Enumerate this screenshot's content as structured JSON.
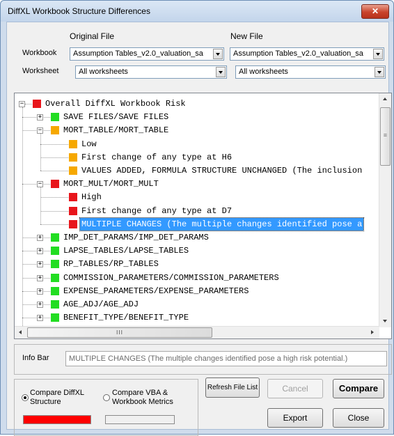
{
  "window": {
    "title": "DiffXL Workbook Structure Differences",
    "close_glyph": "✕"
  },
  "labels": {
    "original_file": "Original File",
    "new_file": "New File",
    "workbook": "Workbook",
    "worksheet": "Worksheet",
    "info_bar": "Info Bar"
  },
  "original": {
    "workbook_value": "Assumption Tables_v2.0_valuation_sa",
    "worksheet_value": "All worksheets"
  },
  "new": {
    "workbook_value": "Assumption Tables_v2.0_valuation_sa",
    "worksheet_value": "All worksheets"
  },
  "tree": {
    "nodes": [
      {
        "text": "Overall DiffXL Workbook Risk",
        "color": "#e8151b",
        "level": 0,
        "toggle": "−"
      },
      {
        "text": "SAVE FILES/SAVE FILES",
        "color": "#22dd22",
        "level": 1,
        "toggle": "+"
      },
      {
        "text": "MORT_TABLE/MORT_TABLE",
        "color": "#f6a800",
        "level": 1,
        "toggle": "−"
      },
      {
        "text": "Low",
        "color": "#f6a800",
        "level": 2,
        "toggle": ""
      },
      {
        "text": "First change of any type at H6",
        "color": "#f6a800",
        "level": 2,
        "toggle": ""
      },
      {
        "text": "VALUES ADDED, FORMULA STRUCTURE UNCHANGED (The inclusion",
        "color": "#f6a800",
        "level": 2,
        "toggle": ""
      },
      {
        "text": "MORT_MULT/MORT_MULT",
        "color": "#e8151b",
        "level": 1,
        "toggle": "−"
      },
      {
        "text": "High",
        "color": "#e8151b",
        "level": 2,
        "toggle": ""
      },
      {
        "text": "First change of any type at D7",
        "color": "#e8151b",
        "level": 2,
        "toggle": ""
      },
      {
        "text": "MULTIPLE CHANGES (The multiple changes identified pose a",
        "color": "#e8151b",
        "level": 2,
        "toggle": "",
        "selected": true
      },
      {
        "text": "IMP_DET_PARAMS/IMP_DET_PARAMS",
        "color": "#22dd22",
        "level": 1,
        "toggle": "+"
      },
      {
        "text": "LAPSE_TABLES/LAPSE_TABLES",
        "color": "#22dd22",
        "level": 1,
        "toggle": "+"
      },
      {
        "text": "RP_TABLES/RP_TABLES",
        "color": "#22dd22",
        "level": 1,
        "toggle": "+"
      },
      {
        "text": "COMMISSION_PARAMETERS/COMMISSION_PARAMETERS",
        "color": "#22dd22",
        "level": 1,
        "toggle": "+"
      },
      {
        "text": "EXPENSE_PARAMETERS/EXPENSE_PARAMETERS",
        "color": "#22dd22",
        "level": 1,
        "toggle": "+"
      },
      {
        "text": "AGE_ADJ/AGE_ADJ",
        "color": "#22dd22",
        "level": 1,
        "toggle": "+"
      },
      {
        "text": "BENEFIT_TYPE/BENEFIT_TYPE",
        "color": "#22dd22",
        "level": 1,
        "toggle": "+"
      }
    ],
    "hscroll_grip": "III",
    "vscroll_grip": "≡"
  },
  "info_bar": {
    "value": "MULTIPLE CHANGES (The multiple changes identified pose a high risk potential.)"
  },
  "options": {
    "compare_structure": "Compare DiffXL\nStructure",
    "compare_vba": "Compare VBA &\nWorkbook Metrics",
    "selected": "structure",
    "structure_indicator_color": "#ff0000",
    "vba_indicator_color": "#f0f0f0"
  },
  "buttons": {
    "refresh": "Refresh File List",
    "cancel": "Cancel",
    "compare": "Compare",
    "export": "Export",
    "close": "Close"
  },
  "colors": {
    "selection": "#3399ff",
    "high": "#e8151b",
    "medium": "#f6a800",
    "low": "#22dd22"
  }
}
